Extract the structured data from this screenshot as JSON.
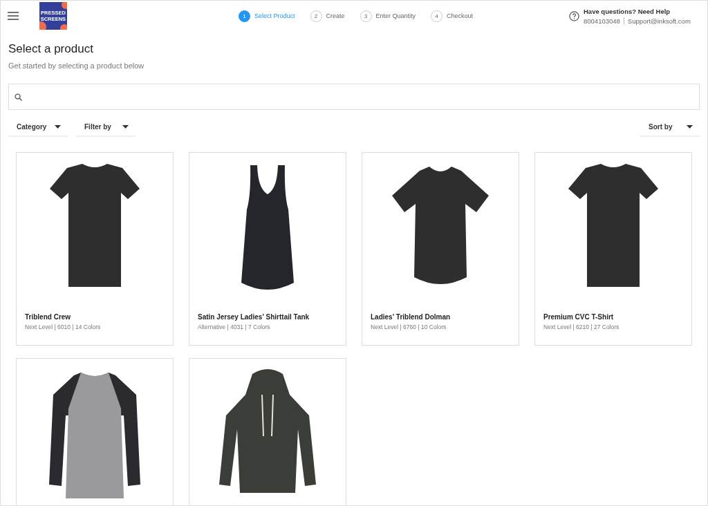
{
  "logo": {
    "lines": [
      "PRESSED",
      "SCREENS"
    ]
  },
  "steps": [
    {
      "number": "1",
      "label": "Select Product",
      "selected": true
    },
    {
      "number": "2",
      "label": "Create",
      "selected": false
    },
    {
      "number": "3",
      "label": "Enter Quantity",
      "selected": false
    },
    {
      "number": "4",
      "label": "Checkout",
      "selected": false
    }
  ],
  "help": {
    "title": "Have questions? Need Help",
    "phone": "8004103048",
    "email": "Support@inksoft.com"
  },
  "page": {
    "title": "Select a product",
    "subtitle": "Get started by selecting a product below"
  },
  "filters": [
    {
      "label": "Category"
    },
    {
      "label": "Filter by"
    }
  ],
  "sort": {
    "label": "Sort by"
  },
  "products": [
    {
      "kind": "tee",
      "name": "Triblend Crew",
      "details": "Next Level | 6010 | 14 Colors"
    },
    {
      "kind": "tank",
      "name": "Satin Jersey Ladies' Shirttail Tank",
      "details": "Alternative | 4031 | 7 Colors"
    },
    {
      "kind": "dolman",
      "name": "Ladies' Triblend Dolman",
      "details": "Next Level | 6760 | 10 Colors"
    },
    {
      "kind": "tee",
      "name": "Premium CVC T-Shirt",
      "details": "Next Level | 6210 | 27 Colors"
    },
    {
      "kind": "raglan"
    },
    {
      "kind": "hoodie"
    }
  ]
}
